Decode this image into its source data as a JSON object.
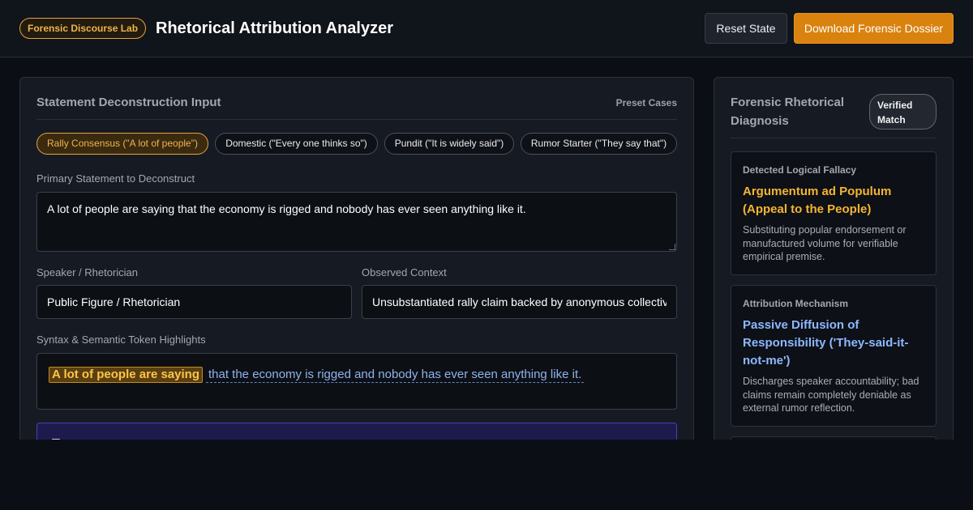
{
  "header": {
    "badge": "Forensic Discourse Lab",
    "title": "Rhetorical Attribution Analyzer",
    "reset_label": "Reset State",
    "download_label": "Download Forensic Dossier"
  },
  "input_panel": {
    "title": "Statement Deconstruction Input",
    "preset_label": "Preset Cases",
    "presets": [
      "Rally Consensus (\"A lot of people\")",
      "Domestic (\"Every one thinks so\")",
      "Pundit (\"It is widely said\")",
      "Rumor Starter (\"They say that\")"
    ],
    "active_preset_index": 0,
    "statement_label": "Primary Statement to Deconstruct",
    "statement_value": "A lot of people are saying that the economy is rigged and nobody has ever seen anything like it.",
    "speaker_label": "Speaker / Rhetorician",
    "speaker_value": "Public Figure / Rhetorician",
    "context_label": "Observed Context",
    "context_value": "Unsubstantiated rally claim backed by anonymous collective",
    "tokens_label": "Syntax & Semantic Token Highlights",
    "tokens": {
      "highlighted": "A lot of people are saying",
      "rest": "that the economy is rigged and nobody has ever seen anything like it."
    }
  },
  "diagnosis_panel": {
    "title": "Forensic Rhetorical Diagnosis",
    "status_badge": "Verified Match",
    "cards": [
      {
        "kicker": "Detected Logical Fallacy",
        "heading": "Argumentum ad Populum (Appeal to the People)",
        "description": "Substituting popular endorsement or manufactured volume for verifiable empirical premise.",
        "accent": "#f5b532"
      },
      {
        "kicker": "Attribution Mechanism",
        "heading": "Passive Diffusion of Responsibility ('They-said-it-not-me')",
        "description": "Discharges speaker accountability; bad claims remain completely deniable as external rumor reflection.",
        "accent": "#8db8ff"
      }
    ]
  },
  "colors": {
    "accent_orange": "#d9820e",
    "highlight_amber": "#f5b532",
    "link_blue": "#8db8ff",
    "callout_purple": "#1d1b4d"
  }
}
